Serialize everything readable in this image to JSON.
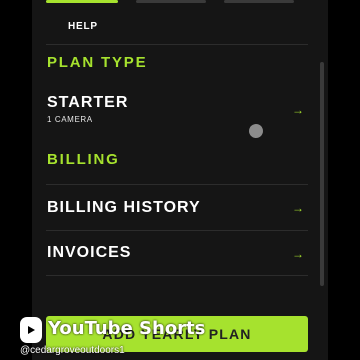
{
  "colors": {
    "accent": "#a6e22e",
    "background": "#000000",
    "panel": "#151515",
    "text": "#ffffff"
  },
  "header": {
    "help_label": "HELP"
  },
  "sections": {
    "plan_type": "PLAN TYPE",
    "billing": "BILLING"
  },
  "plan": {
    "name": "STARTER",
    "detail": "1 CAMERA"
  },
  "menu": {
    "billing_history": "BILLING HISTORY",
    "invoices": "INVOICES"
  },
  "cta": {
    "label": "ADD YEARLY PLAN"
  },
  "overlay": {
    "brand": "YouTube Shorts",
    "channel": "@cedargroveoutdoors1"
  },
  "icons": {
    "arrow": "→",
    "shorts_logo": "youtube-shorts-icon"
  }
}
